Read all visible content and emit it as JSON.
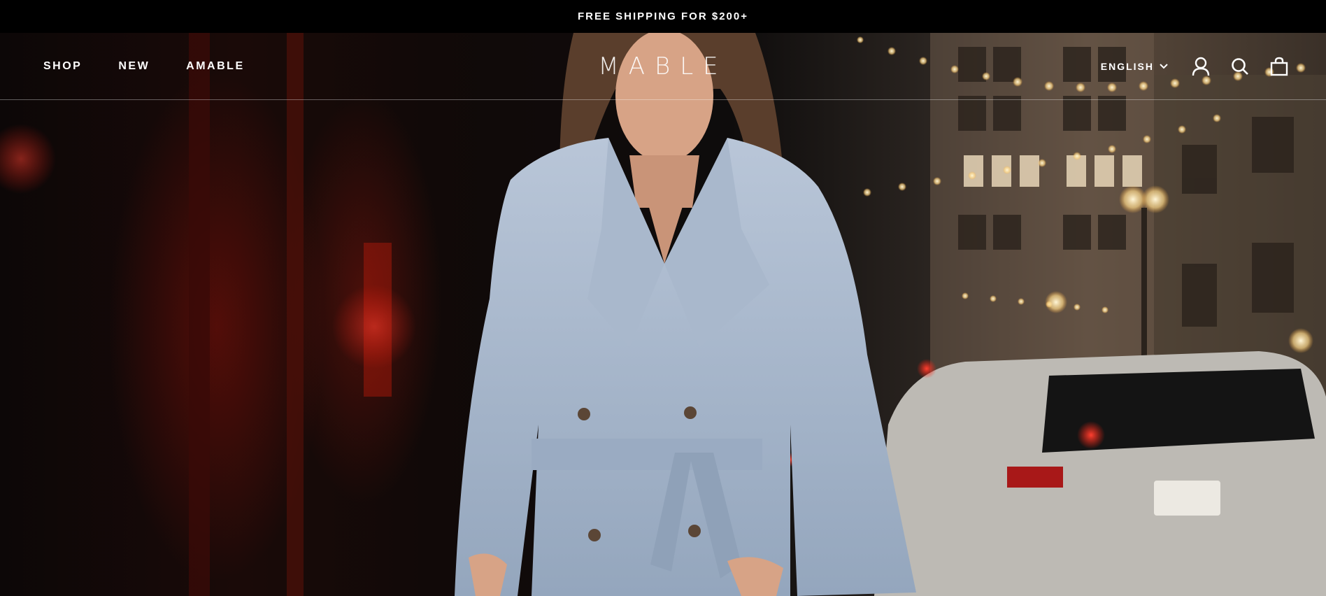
{
  "announcement": {
    "text": "FREE SHIPPING FOR $200+"
  },
  "header": {
    "logo": "MABLE",
    "nav": [
      {
        "label": "SHOP"
      },
      {
        "label": "NEW"
      },
      {
        "label": "AMABLE"
      }
    ],
    "language": {
      "selected": "ENGLISH"
    },
    "icons": [
      "account-icon",
      "search-icon",
      "cart-icon"
    ]
  },
  "colors": {
    "announcement_bg": "#000000",
    "text": "#ffffff"
  }
}
